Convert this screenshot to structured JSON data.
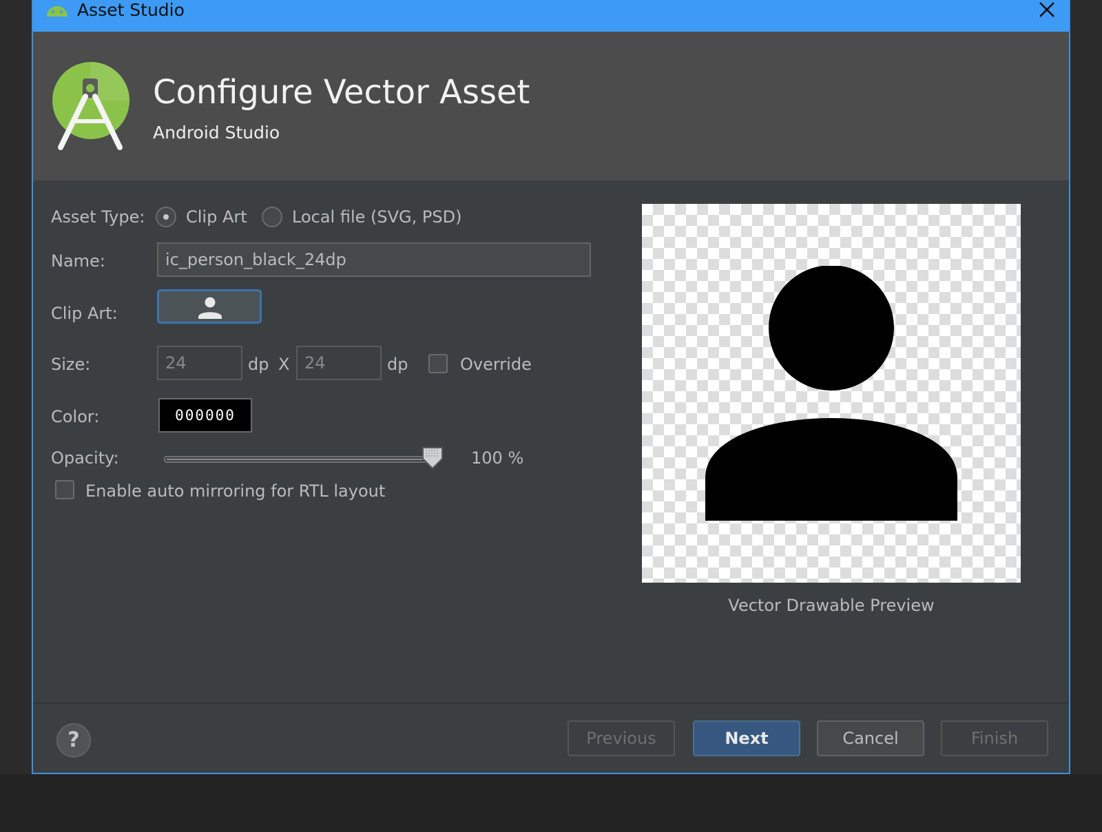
{
  "window": {
    "title": "Asset Studio"
  },
  "header": {
    "title": "Configure Vector Asset",
    "subtitle": "Android Studio"
  },
  "form": {
    "asset_type": {
      "label": "Asset Type:",
      "options": [
        "Clip Art",
        "Local file (SVG, PSD)"
      ],
      "selected": "Clip Art"
    },
    "name": {
      "label": "Name:",
      "value": "ic_person_black_24dp"
    },
    "clip_art": {
      "label": "Clip Art:",
      "icon": "person-icon"
    },
    "size": {
      "label": "Size:",
      "width": "24",
      "height": "24",
      "unit": "dp",
      "separator": "X",
      "override_label": "Override",
      "override_checked": false
    },
    "color": {
      "label": "Color:",
      "value": "000000"
    },
    "opacity": {
      "label": "Opacity:",
      "value": 100,
      "display": "100 %"
    },
    "auto_mirror": {
      "label": "Enable auto mirroring for RTL layout",
      "checked": false
    }
  },
  "preview": {
    "caption": "Vector Drawable Preview",
    "icon": "person-icon"
  },
  "footer": {
    "help_icon": "help-icon",
    "help_label": "?",
    "buttons": {
      "previous": "Previous",
      "next": "Next",
      "cancel": "Cancel",
      "finish": "Finish"
    }
  },
  "colors": {
    "titlebar": "#3d9bf5",
    "dialog_bg": "#3c3f41",
    "header_bg": "#4c4c4c",
    "primary_button": "#365880",
    "android_green": "#8bc34a"
  }
}
